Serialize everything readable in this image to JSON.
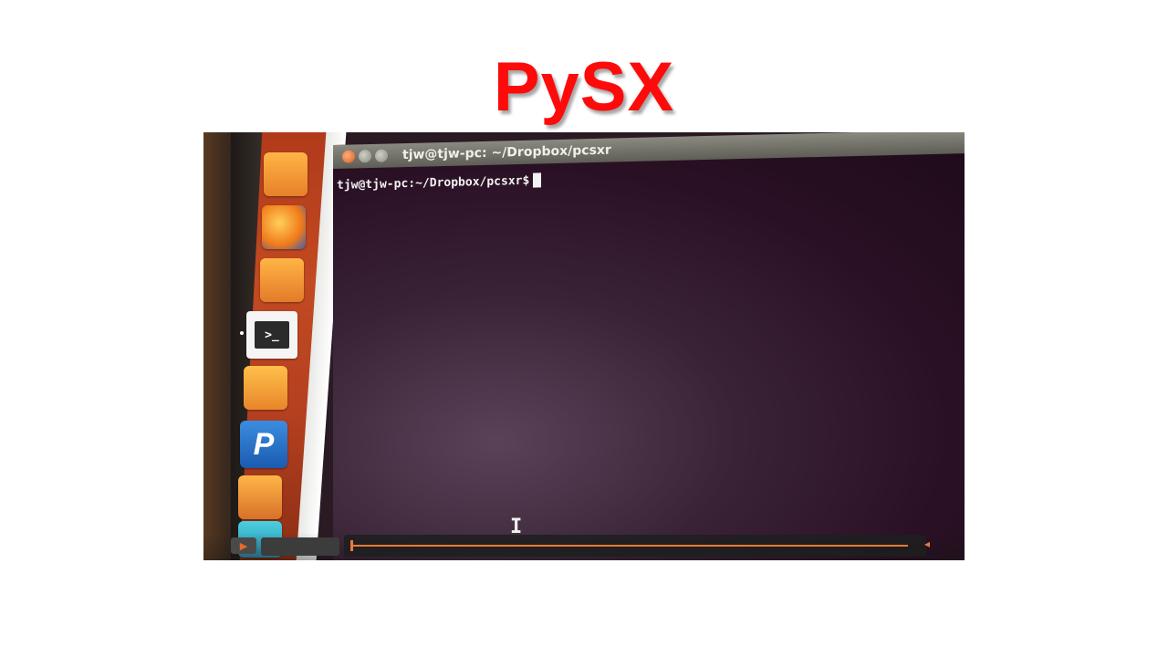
{
  "title": "PySX",
  "terminal": {
    "window_title": "tjw@tjw-pc: ~/Dropbox/pcsxr",
    "prompt": "tjw@tjw-pc:~/Dropbox/pcsxr$"
  },
  "launcher": {
    "items": [
      "home-folder-icon",
      "firefox-icon",
      "files-icon",
      "terminal-icon",
      "folder-icon",
      "pcsx-icon",
      "package-icon",
      "software-center-icon"
    ],
    "terminal_glyph": ">_",
    "pcsx_glyph": "P"
  },
  "player": {
    "play_glyph": "▶",
    "volume_glyph": "◂",
    "progress": 0.0
  },
  "colors": {
    "title": "#ff0a0a",
    "progress_accent": "#e87a3a",
    "launcher": "#c24a22"
  }
}
